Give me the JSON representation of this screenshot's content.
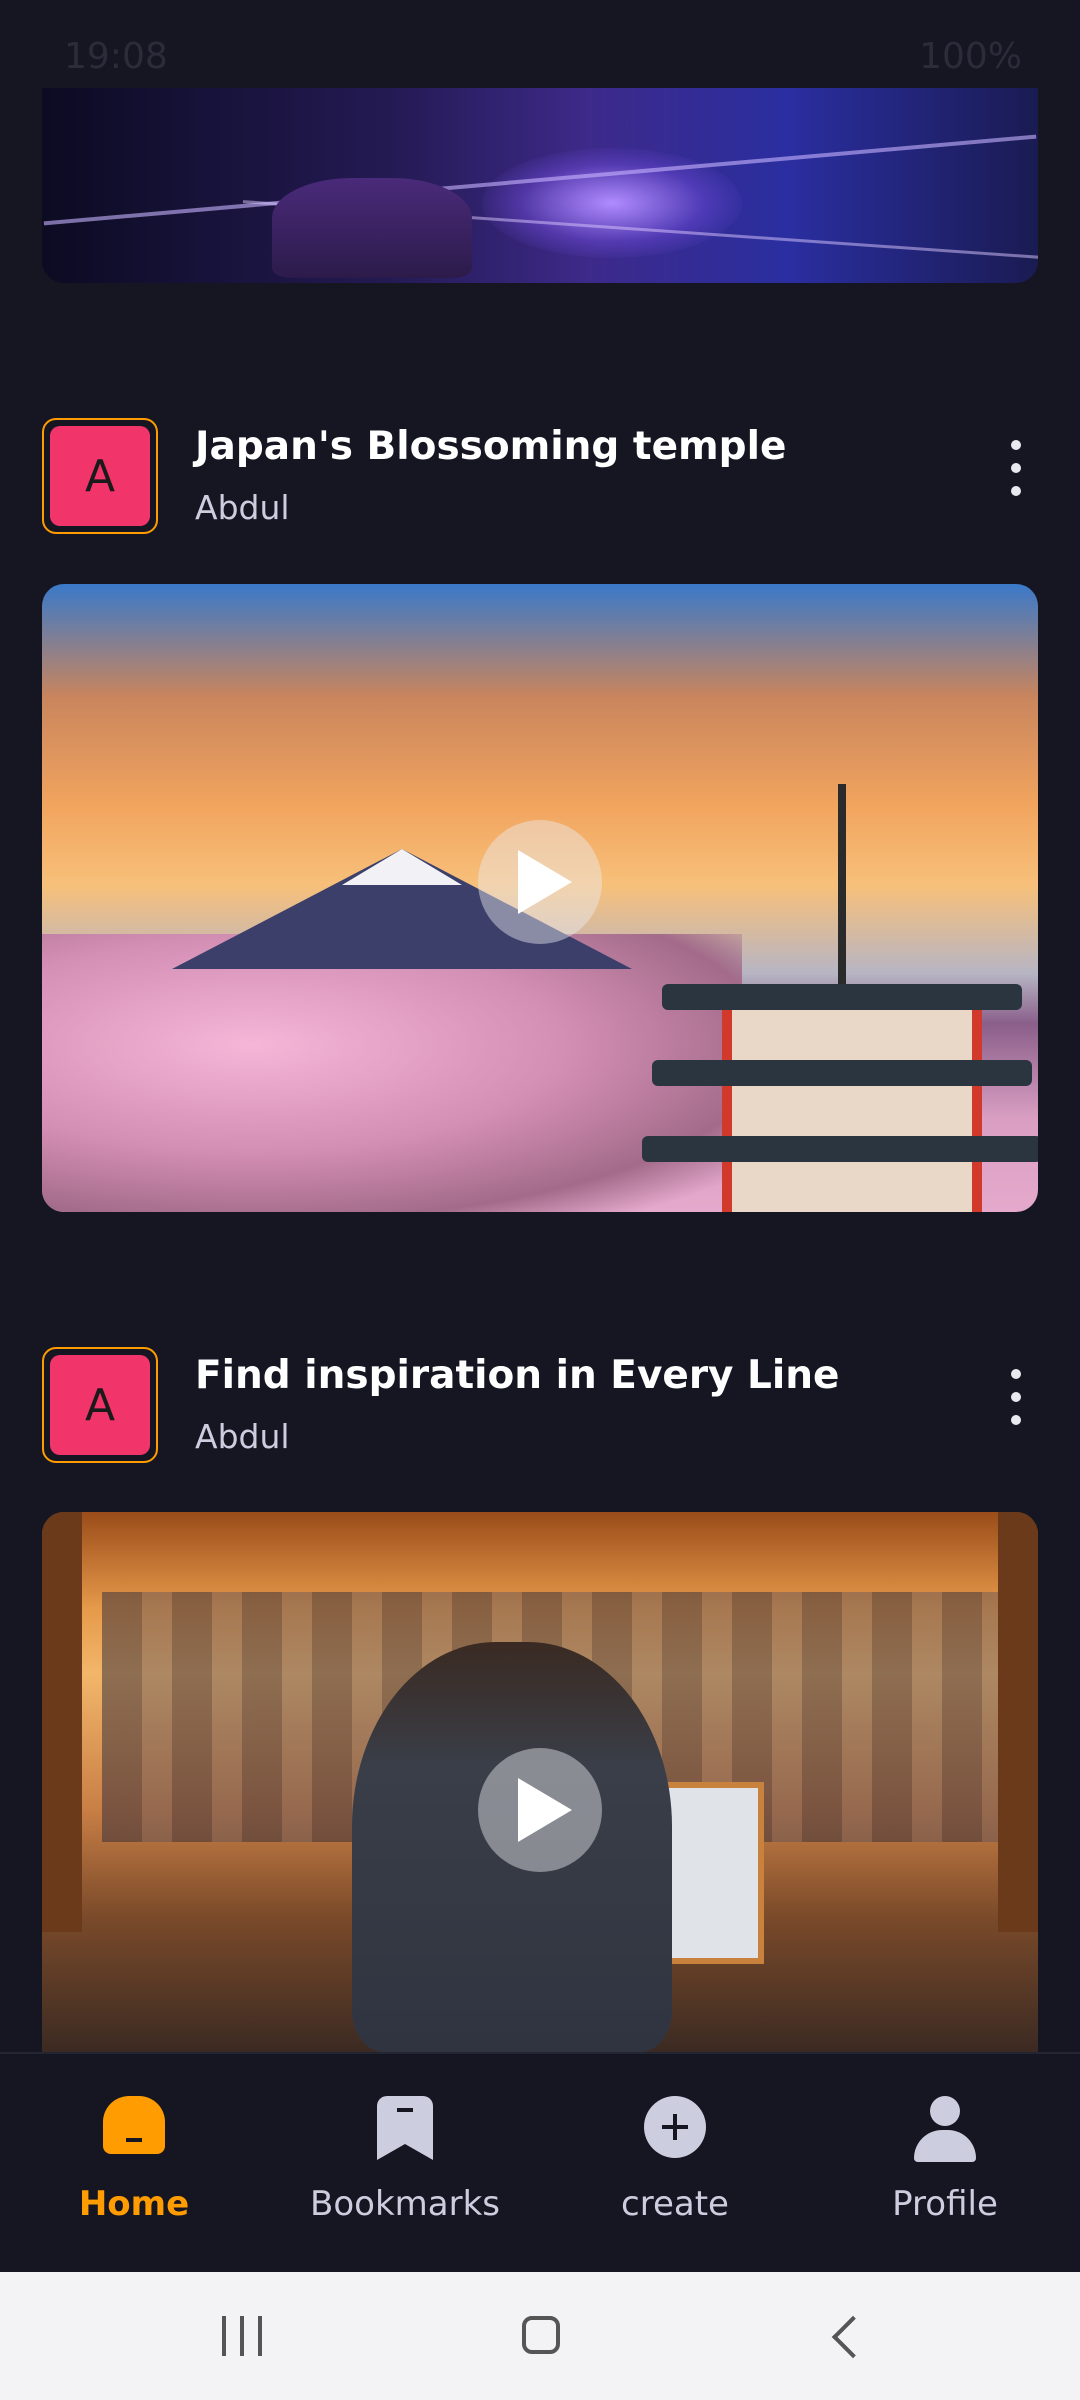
{
  "status_bar": {
    "time": "19:08",
    "battery": "100%"
  },
  "posts": [
    {
      "title": "Japan's Blossoming temple",
      "author": "Abdul",
      "avatar_letter": "A"
    },
    {
      "title": "Find inspiration in Every Line",
      "author": "Abdul",
      "avatar_letter": "A"
    }
  ],
  "tabs": [
    {
      "label": "Home",
      "icon": "home-icon",
      "active": true
    },
    {
      "label": "Bookmarks",
      "icon": "bookmark-icon",
      "active": false
    },
    {
      "label": "create",
      "icon": "plus-circle-icon",
      "active": false
    },
    {
      "label": "Profile",
      "icon": "profile-icon",
      "active": false
    }
  ],
  "colors": {
    "background": "#161622",
    "accent": "#FF9C01",
    "avatar_fill": "#F1346A",
    "inactive": "#CDCDE0"
  }
}
